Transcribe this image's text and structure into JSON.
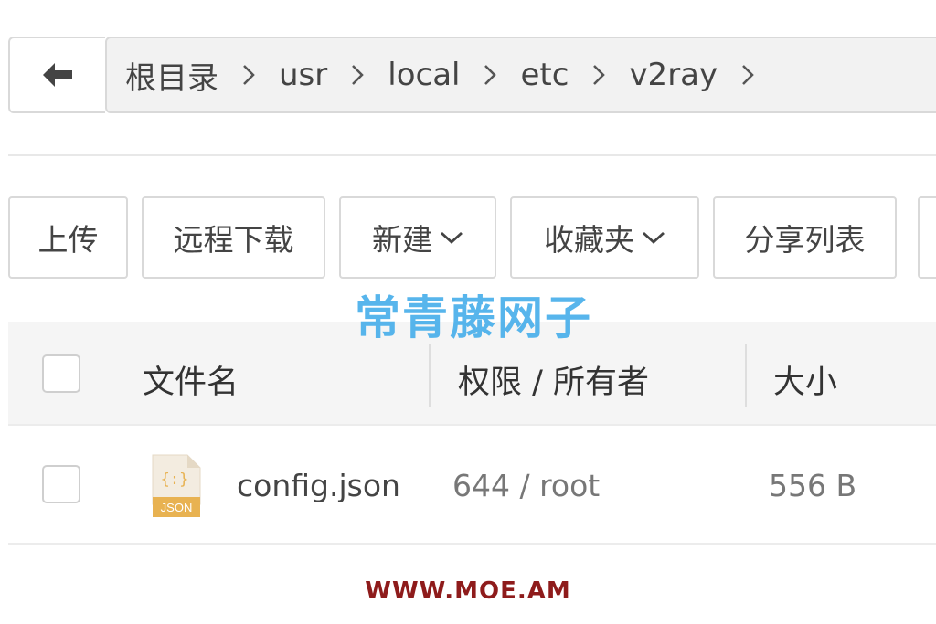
{
  "breadcrumb": {
    "items": [
      "根目录",
      "usr",
      "local",
      "etc",
      "v2ray"
    ]
  },
  "toolbar": {
    "upload_label": "上传",
    "remote_download_label": "远程下载",
    "new_label": "新建",
    "favorites_label": "收藏夹",
    "share_list_label": "分享列表"
  },
  "watermark": "常青藤网子",
  "table": {
    "columns": [
      "文件名",
      "权限 / 所有者",
      "大小"
    ],
    "rows": [
      {
        "name": "config.json",
        "permission": "644 / root",
        "size": "556 B",
        "icon": "json-file-icon",
        "icon_label": "JSON"
      }
    ]
  },
  "footer": "WWW.MOE.AM",
  "colors": {
    "watermark": "#45aeea",
    "json_icon": "#e8b251",
    "footer": "#8e1b1b",
    "border": "#d9d9d9"
  }
}
